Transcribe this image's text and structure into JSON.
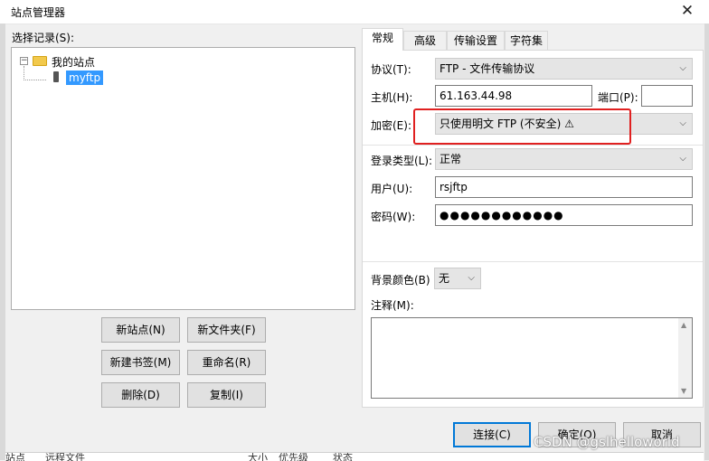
{
  "window": {
    "title": "站点管理器",
    "close_glyph": "✕"
  },
  "left": {
    "select_label": "选择记录(S):",
    "tree": {
      "root": "我的站点",
      "child": "myftp"
    },
    "buttons": {
      "new_site": "新站点(N)",
      "new_folder": "新文件夹(F)",
      "new_bookmark": "新建书签(M)",
      "rename": "重命名(R)",
      "delete": "删除(D)",
      "copy": "复制(I)"
    }
  },
  "tabs": [
    "常规",
    "高级",
    "传输设置",
    "字符集"
  ],
  "general": {
    "protocol_label": "协议(T):",
    "protocol_value": "FTP - 文件传输协议",
    "host_label": "主机(H):",
    "host_value": "61.163.44.98",
    "port_label": "端口(P):",
    "port_value": "",
    "encryption_label": "加密(E):",
    "encryption_value": "只使用明文 FTP (不安全) ⚠",
    "login_type_label": "登录类型(L):",
    "login_type_value": "正常",
    "user_label": "用户(U):",
    "user_value": "rsjftp",
    "password_label": "密码(W):",
    "password_value": "●●●●●●●●●●●●",
    "bg_color_label": "背景颜色(B)",
    "bg_color_value": "无",
    "comments_label": "注释(M):"
  },
  "dialog_buttons": {
    "connect": "连接(C)",
    "ok": "确定(O)",
    "cancel": "取消"
  },
  "background_strip": {
    "col1": "站点",
    "col2": "远程文件",
    "col3": "大小",
    "col4": "优先级",
    "col5": "状态"
  },
  "watermark": "CSDN @gslhelloworld",
  "colors": {
    "accent": "#0078d7",
    "highlight_box": "#e02020",
    "selection": "#3399ff"
  }
}
